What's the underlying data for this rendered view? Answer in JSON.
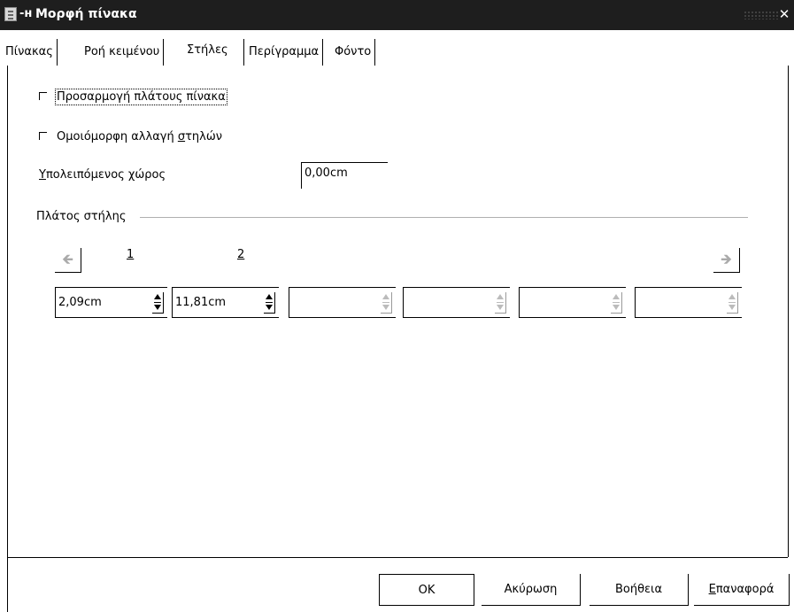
{
  "window": {
    "title": "Μορφή πίνακα",
    "menu_glyph": "-ʜ"
  },
  "tabs": [
    {
      "label": "Πίνακας",
      "active": false
    },
    {
      "label": "Ροή κειμένου",
      "active": false
    },
    {
      "label": "Στήλες",
      "active": true
    },
    {
      "label": "Περίγραμμα",
      "active": false
    },
    {
      "label": "Φόντο",
      "active": false
    }
  ],
  "options": {
    "adapt_width": {
      "label": "Προσαρμογή πλάτους πίνακα",
      "checked": false
    },
    "adjust_columns": {
      "label_pre": "Ομοιόμορφη αλλαγή ",
      "label_access": "σ",
      "label_post": "τηλών",
      "checked": false
    }
  },
  "remaining": {
    "label_access": "Υ",
    "label_rest": "πολειπόμενος χώρος",
    "value": "0,00cm"
  },
  "column_width": {
    "section_label": "Πλάτος στήλης",
    "column_numbers": [
      "1",
      "2"
    ],
    "left_arrow": "🡸",
    "right_arrow": "🡺",
    "values": [
      "2,09cm",
      "11,81cm",
      "",
      "",
      "",
      ""
    ]
  },
  "buttons": {
    "ok": "OK",
    "cancel": "Ακύρωση",
    "help": "Βοήθεια",
    "reset_access": "Ε",
    "reset_rest": "παναφορά"
  },
  "colors": {
    "titlebar": "#1e1e1e",
    "background": "#ffffff"
  }
}
